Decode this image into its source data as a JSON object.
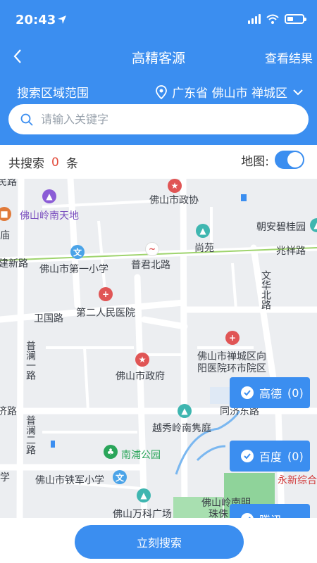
{
  "status": {
    "time": "20:43"
  },
  "nav": {
    "title": "高精客源",
    "action": "查看结果"
  },
  "area": {
    "label": "搜索区域范围",
    "value": "广东省 佛山市 禅城区"
  },
  "search": {
    "placeholder": "请输入关键字",
    "value": ""
  },
  "summary": {
    "prefix": "共搜索",
    "count": "0",
    "suffix": "条",
    "map_label": "地图:",
    "map_on": true
  },
  "map": {
    "labels": {
      "l1": "佛山岭南天地",
      "l2": "佛山市政协",
      "l3": "朝安碧桂园",
      "l4": "尚苑",
      "l5": "兆祥路",
      "l6": "建新路",
      "l7": "佛山市第一小学",
      "l8": "普君北路",
      "l9": "文华北路",
      "l10": "第二人民医院",
      "l11": "卫国路",
      "l12": "佛山市禅城区向",
      "l13": "阳医院环市院区",
      "l14": "普澜一路",
      "l15": "佛山市政府",
      "l16": "济路",
      "l17": "同济东路",
      "l18": "越秀岭南隽庭",
      "l19": "普澜二路",
      "l20": "南浦公园",
      "l21": "学",
      "l22": "佛山市铁军小学",
      "l23": "永新综合",
      "l24": "佛山万科广场",
      "l25": "佛山岭南明",
      "l26": "珠侏",
      "l27": "民路",
      "l28": "庙"
    },
    "sources": [
      {
        "name": "高德",
        "count": "(0)"
      },
      {
        "name": "百度",
        "count": "(0)"
      },
      {
        "name": "腾讯",
        "count": ""
      }
    ]
  },
  "bottom": {
    "button": "立刻搜索"
  },
  "colors": {
    "primary": "#3b8ef0",
    "count_red": "#e24b3b"
  }
}
